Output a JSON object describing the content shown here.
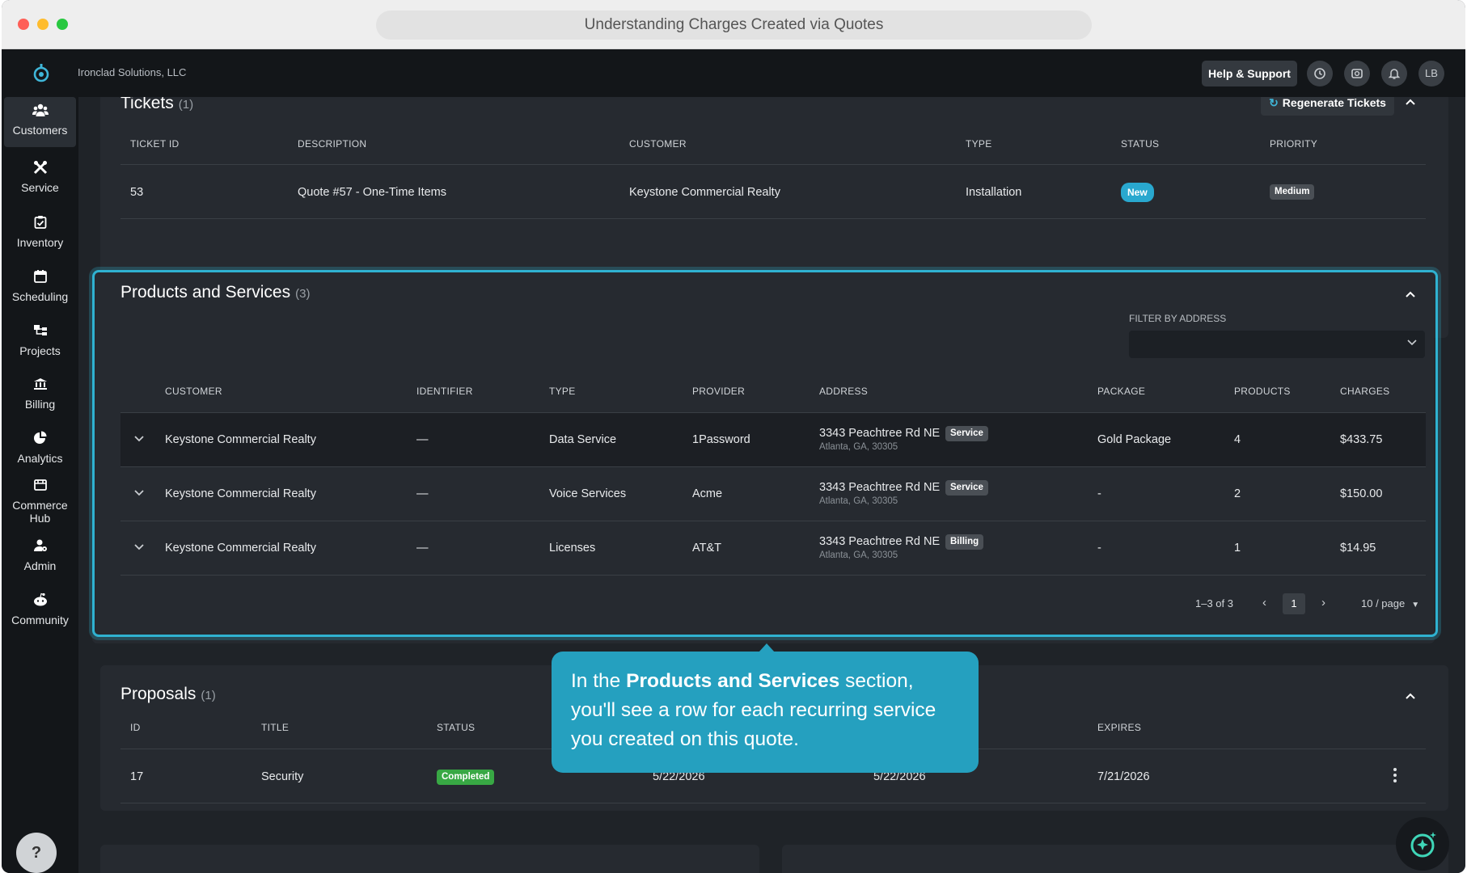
{
  "window": {
    "title": "Understanding Charges Created via Quotes"
  },
  "topnav": {
    "org_name": "Ironclad Solutions, LLC",
    "help_label": "Help & Support",
    "avatar_initials": "LB"
  },
  "sidebar": {
    "items": [
      {
        "label": "Customers",
        "icon": "customers-icon"
      },
      {
        "label": "Service",
        "icon": "service-icon"
      },
      {
        "label": "Inventory",
        "icon": "inventory-icon"
      },
      {
        "label": "Scheduling",
        "icon": "scheduling-icon"
      },
      {
        "label": "Projects",
        "icon": "projects-icon"
      },
      {
        "label": "Billing",
        "icon": "billing-icon"
      },
      {
        "label": "Analytics",
        "icon": "analytics-icon"
      },
      {
        "label": "Commerce Hub",
        "icon": "commerce-hub-icon"
      },
      {
        "label": "Admin",
        "icon": "admin-icon"
      },
      {
        "label": "Community",
        "icon": "community-icon"
      }
    ],
    "help_glyph": "?"
  },
  "tickets": {
    "title": "Tickets",
    "count": "(1)",
    "regenerate_label": "Regenerate Tickets",
    "columns": [
      "TICKET ID",
      "DESCRIPTION",
      "CUSTOMER",
      "TYPE",
      "STATUS",
      "PRIORITY"
    ],
    "rows": [
      {
        "id": "53",
        "description": "Quote #57 - One-Time Items",
        "customer": "Keystone Commercial Realty",
        "type": "Installation",
        "status": "New",
        "priority": "Medium"
      }
    ]
  },
  "products": {
    "title": "Products and Services",
    "count": "(3)",
    "filter_label": "FILTER BY ADDRESS",
    "columns": [
      "CUSTOMER",
      "IDENTIFIER",
      "TYPE",
      "PROVIDER",
      "ADDRESS",
      "PACKAGE",
      "PRODUCTS",
      "CHARGES"
    ],
    "rows": [
      {
        "customer": "Keystone Commercial Realty",
        "identifier": "—",
        "type": "Data Service",
        "provider": "1Password",
        "address_line1": "3343 Peachtree Rd NE",
        "address_line2": "Atlanta, GA, 30305",
        "address_tag": "Service",
        "package": "Gold Package",
        "products": "4",
        "charges": "$433.75"
      },
      {
        "customer": "Keystone Commercial Realty",
        "identifier": "—",
        "type": "Voice Services",
        "provider": "Acme",
        "address_line1": "3343 Peachtree Rd NE",
        "address_line2": "Atlanta, GA, 30305",
        "address_tag": "Service",
        "package": "-",
        "products": "2",
        "charges": "$150.00"
      },
      {
        "customer": "Keystone Commercial Realty",
        "identifier": "—",
        "type": "Licenses",
        "provider": "AT&T",
        "address_line1": "3343 Peachtree Rd NE",
        "address_line2": "Atlanta, GA, 30305",
        "address_tag": "Billing",
        "package": "-",
        "products": "1",
        "charges": "$14.95"
      }
    ],
    "pagination": {
      "range": "1–3 of 3",
      "current_page": "1",
      "page_size": "10 / page"
    }
  },
  "proposals": {
    "title": "Proposals",
    "count": "(1)",
    "columns": [
      "ID",
      "TITLE",
      "STATUS",
      "EXPIRES"
    ],
    "rows": [
      {
        "id": "17",
        "title": "Security",
        "status": "Completed",
        "date1": "5/22/2026",
        "date2": "5/22/2026",
        "expires": "7/21/2026"
      }
    ]
  },
  "tooltip": {
    "pre": "In the ",
    "bold": "Products and Services",
    "post": " section, you'll see a row for each recurring service you created on this quote."
  },
  "colors": {
    "accent": "#2fb2d1",
    "tooltip_bg": "#25a0bf",
    "status_new": "#29a8cf",
    "status_completed": "#38a844"
  }
}
